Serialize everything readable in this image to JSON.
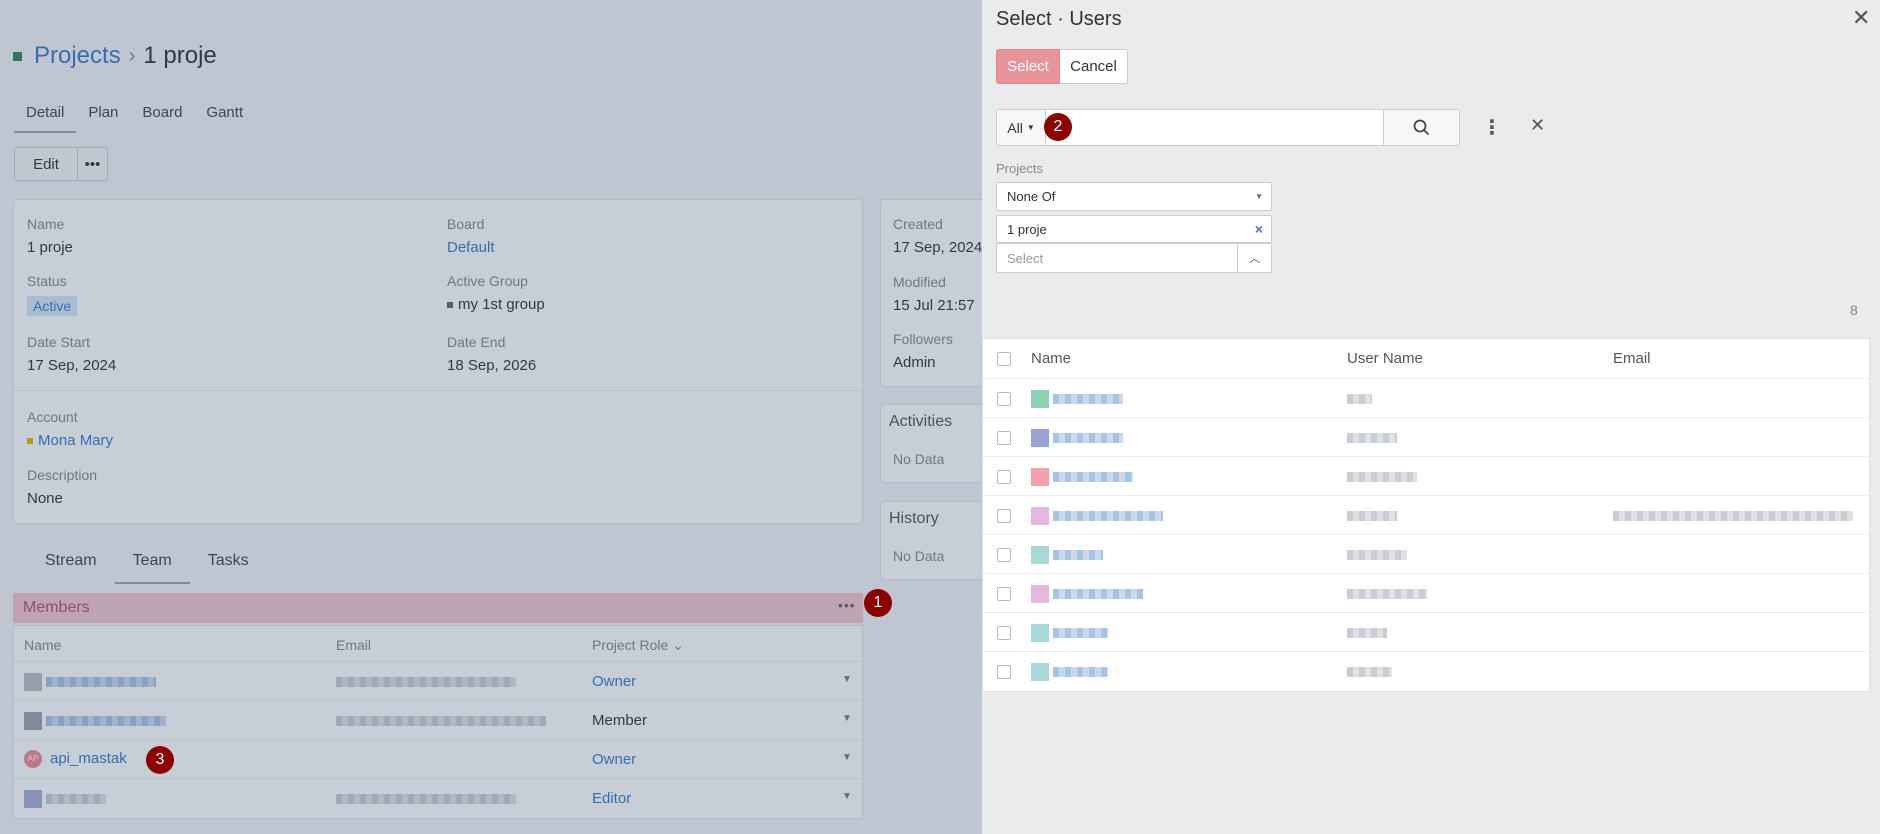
{
  "breadcrumb": {
    "root": "Projects",
    "separator": "›",
    "current": "1 proje"
  },
  "top_tabs": [
    "Detail",
    "Plan",
    "Board",
    "Gantt"
  ],
  "actions": {
    "edit": "Edit",
    "more": "•••"
  },
  "detail": {
    "name_label": "Name",
    "name": "1 proje",
    "board_label": "Board",
    "board": "Default",
    "status_label": "Status",
    "status": "Active",
    "group_label": "Active Group",
    "group": "my 1st group",
    "date_start_label": "Date Start",
    "date_start": "17 Sep, 2024",
    "date_end_label": "Date End",
    "date_end": "18 Sep, 2026",
    "account_label": "Account",
    "account": "Mona Mary",
    "description_label": "Description",
    "description": "None"
  },
  "side": {
    "created_label": "Created",
    "created": "17 Sep, 2024",
    "modified_label": "Modified",
    "modified": "15 Jul 21:57",
    "followers_label": "Followers",
    "followers": "Admin",
    "activities": "Activities",
    "activities_empty": "No Data",
    "history": "History",
    "history_empty": "No Data"
  },
  "bottom_tabs": [
    "Stream",
    "Team",
    "Tasks"
  ],
  "members": {
    "title": "Members",
    "menu": "•••",
    "columns": [
      "Name",
      "Email",
      "Project Role"
    ],
    "role_header_caret": "⌄",
    "rows": [
      {
        "role": "Owner"
      },
      {
        "role": "Member"
      },
      {
        "name": "api_mastak",
        "initials": "AP",
        "role": "Owner"
      },
      {
        "role": "Editor"
      }
    ]
  },
  "markers": [
    "1",
    "2",
    "3"
  ],
  "modal": {
    "title": "Select · Users",
    "close": "✕",
    "select_btn": "Select",
    "cancel_btn": "Cancel",
    "scope": "All",
    "search_placeholder": "",
    "filter_label": "Projects",
    "filter_op": "None Of",
    "filter_chip": "1 proje",
    "filter_pick_placeholder": "Select",
    "count": "8",
    "columns": [
      "Name",
      "User Name",
      "Email"
    ],
    "row_count": 8
  },
  "colors": {
    "accent": "#3c7bc8",
    "primary_btn": "#e7959a",
    "members_bar": "#f5c6cb",
    "marker": "#8b0000"
  }
}
